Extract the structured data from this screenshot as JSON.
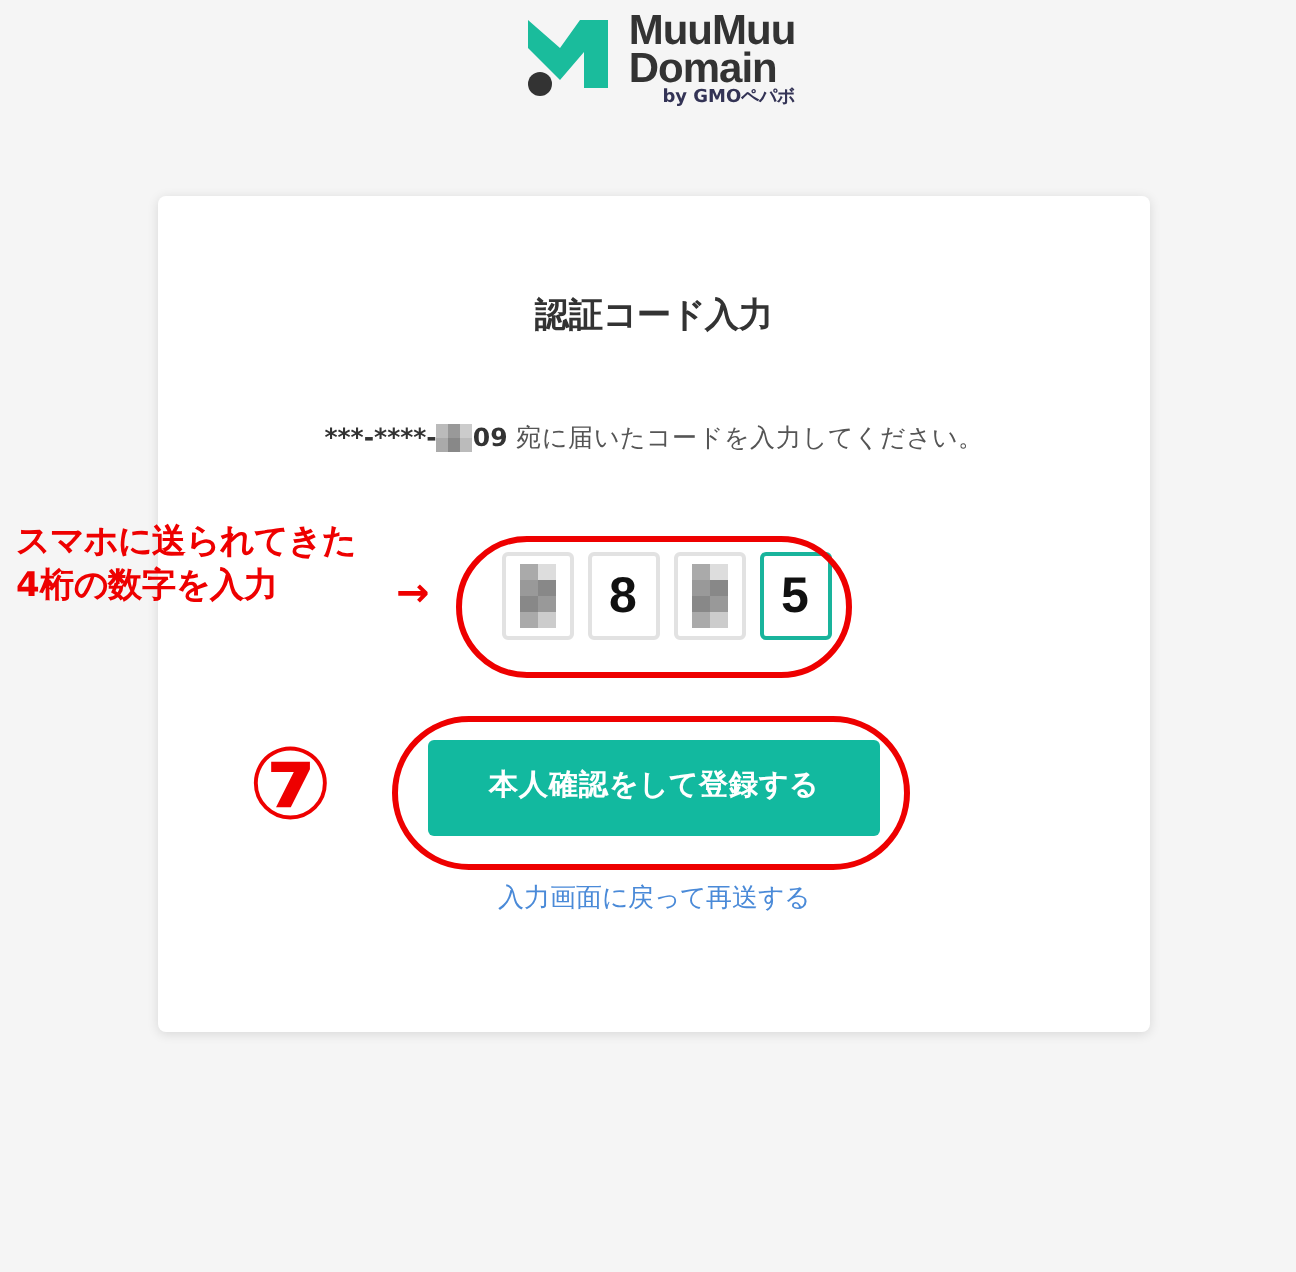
{
  "logo": {
    "line_1": "MuuMuu",
    "line_2": "Domain",
    "byline": "by GMOペパボ"
  },
  "card": {
    "title": "認証コード入力",
    "phone_prefix": "***-****-",
    "phone_suffix": "09",
    "message": " 宛に届いたコードを入力してください。",
    "code_boxes": [
      {
        "kind": "pixelated",
        "focused": false
      },
      {
        "kind": "digit",
        "value": "8",
        "focused": false
      },
      {
        "kind": "pixelated",
        "focused": false
      },
      {
        "kind": "digit",
        "value": "5",
        "focused": true
      }
    ],
    "submit_button": "本人確認をして登録する",
    "resend_link": "入力画面に戻って再送する"
  },
  "annotations": {
    "note_lines": [
      "スマホに送られてきた",
      "4桁の数字を入力"
    ],
    "arrow": "→",
    "step_number": "⑦"
  }
}
